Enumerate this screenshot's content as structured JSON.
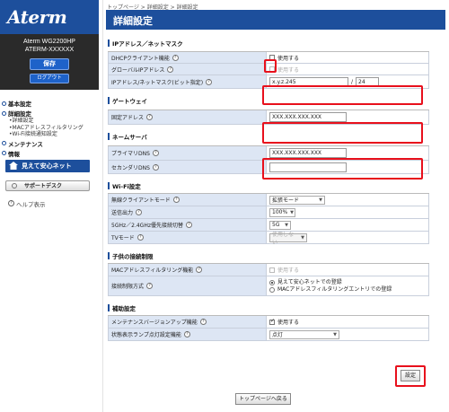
{
  "sidebar": {
    "logo": "Aterm",
    "model_line1": "Aterm  WG2200HP",
    "model_line2": "ATERM-XXXXXX",
    "save_label": "保存",
    "logout_label": "ログアウト",
    "nav": {
      "basic": "基本設定",
      "detail": "詳細設定",
      "detail_items": [
        "•詳細設定",
        "•MACアドレスフィルタリング",
        "•Wi-Fi接続通知設定"
      ],
      "maintenance": "メンテナンス",
      "info": "情報",
      "mimamori": "見えて安心ネット"
    },
    "support_label": "サポートデスク",
    "help_label": "ヘルプ表示"
  },
  "header": {
    "breadcrumb": "トップページ > 詳細設定 > 詳細設定",
    "title": "詳細設定"
  },
  "sections": {
    "ip": {
      "title": "IPアドレス／ネットマスク",
      "dhcp_label": "DHCPクライアント機能",
      "dhcp_value": "使用する",
      "global_label": "グローバルIPアドレス",
      "global_value": "使用する",
      "ipmask_label": "IPアドレス/ネットマスク(ビット指定)",
      "ip_value": "x.y.z.245",
      "slash": "/",
      "mask_value": "24"
    },
    "gateway": {
      "title": "ゲートウェイ",
      "fixed_label": "固定アドレス",
      "fixed_value": "XXX.XXX.XXX.XXX"
    },
    "dns": {
      "title": "ネームサーバ",
      "primary_label": "プライマリDNS",
      "primary_value": "XXX.XXX.XXX.XXX",
      "secondary_label": "セカンダリDNS",
      "secondary_value": ""
    },
    "wifi": {
      "title": "Wi-Fi設定",
      "client_label": "無線クライアントモード",
      "client_value": "拡張モード",
      "power_label": "送信出力",
      "power_value": "100%",
      "band_label": "5GHz／2.4GHz優先接続切替",
      "band_value": "5G",
      "tv_label": "TVモード",
      "tv_value": "使用しない"
    },
    "child": {
      "title": "子供の接続制限",
      "mac_label": "MACアドレスフィルタリング機能",
      "mac_value": "使用する",
      "method_label": "接続制限方式",
      "method_opt1": "見えて安心ネットでの登録",
      "method_opt2": "MACアドレスフィルタリングエントリでの登録"
    },
    "aux": {
      "title": "補助設定",
      "maint_label": "メンテナンスバージョンアップ機能",
      "maint_value": "使用する",
      "lamp_label": "状態表示ランプ点灯設定機能",
      "lamp_value": "点灯"
    }
  },
  "buttons": {
    "set": "設定",
    "top": "トップページへ戻る"
  },
  "icons": {
    "help": "?",
    "dropdown": "▼"
  },
  "colors": {
    "brand_blue": "#1d4f9c",
    "highlight_red": "#e8101c",
    "label_bg": "#dde6f4"
  }
}
